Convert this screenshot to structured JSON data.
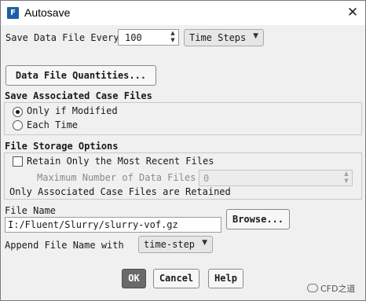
{
  "window": {
    "title": "Autosave",
    "app_icon_letter": "F",
    "close_glyph": "✕"
  },
  "save_data": {
    "label": "Save Data File Every",
    "value": "100",
    "unit_selected": "Time Steps"
  },
  "quantities_button": "Data File Quantities...",
  "case_files": {
    "title": "Save Associated Case Files",
    "options": [
      {
        "label": "Only if Modified",
        "checked": true
      },
      {
        "label": "Each Time",
        "checked": false
      }
    ]
  },
  "storage": {
    "title": "File Storage Options",
    "retain_label": "Retain Only the Most Recent Files",
    "retain_checked": false,
    "max_files_label": "Maximum Number of Data Files",
    "max_files_value": "0",
    "note": "Only Associated Case Files are Retained"
  },
  "file_name": {
    "label": "File Name",
    "value": "I:/Fluent/Slurry/slurry-vof.gz",
    "browse_label": "Browse..."
  },
  "append": {
    "label": "Append File Name with",
    "selected": "time-step"
  },
  "buttons": {
    "ok": "OK",
    "cancel": "Cancel",
    "help": "Help"
  },
  "watermark": "CFD之道",
  "icons": {
    "spin_up": "▲",
    "spin_down": "▼",
    "dropdown": "▼"
  }
}
